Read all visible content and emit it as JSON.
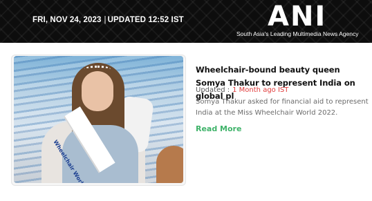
{
  "header": {
    "date": "FRI, NOV 24, 2023",
    "separator": "|",
    "updated": "UPDATED 12:52 IST",
    "logo": "ANI",
    "tagline": "South Asia's Leading Multimedia News Agency",
    "background_color": "#0d0d0d"
  },
  "article": {
    "image_alt": "Somya Thakur wearing a Miss Wheelchair World India sash",
    "sash_text": "Wheelchair World India",
    "headline": "Wheelchair-bound beauty queen Somya Thakur to represent India on global pl",
    "updated_label": "Updated :",
    "updated_value": "1 Month ago IST",
    "summary": "Somya Thakur asked for financial aid to represent India at the Miss Wheelchair World 2022.",
    "read_more": "Read More",
    "colors": {
      "updated_value": "#e03a3a",
      "read_more": "#3fb36a"
    }
  }
}
